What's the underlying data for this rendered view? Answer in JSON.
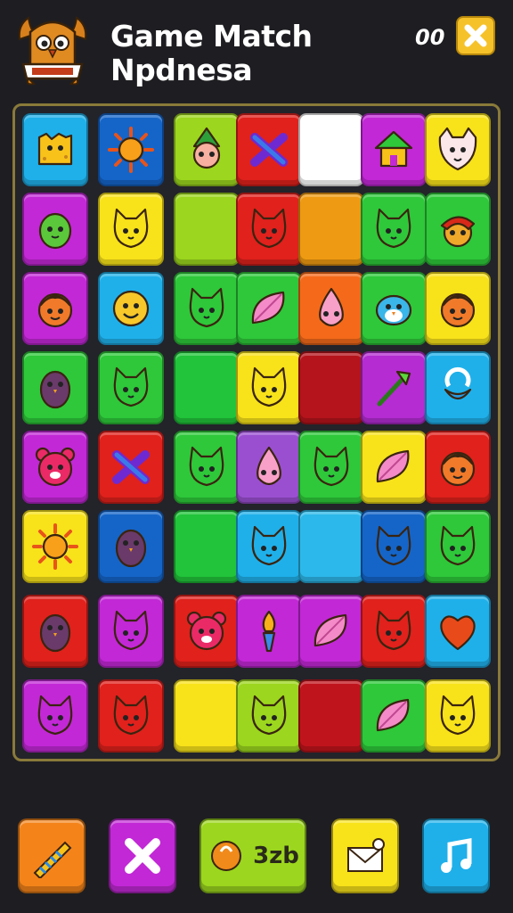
{
  "header": {
    "title_line1": "Game Match",
    "title_line2": "Npdnesa",
    "score": "00"
  },
  "board": {
    "rows": [
      [
        {
          "color": "#1fb0ea",
          "icon": "sponge"
        },
        {
          "color": "#1565c8",
          "icon": "sun"
        },
        {
          "color": "#9cd61e",
          "icon": "gnome"
        },
        {
          "color": "#e0211c",
          "icon": "cross-ribbon"
        },
        {
          "color": "#ffffff",
          "icon": "none"
        },
        {
          "color": "#c228d6",
          "icon": "house"
        },
        {
          "color": "#f8e21a",
          "icon": "fox"
        }
      ],
      [
        {
          "color": "#c228d6",
          "icon": "cactus"
        },
        {
          "color": "#f8e21a",
          "icon": "cat"
        },
        {
          "color": "#9cd61e",
          "icon": "none"
        },
        {
          "color": "#e0211c",
          "icon": "cat"
        },
        {
          "color": "#ee9a12",
          "icon": "none"
        },
        {
          "color": "#2ec83a",
          "icon": "cat"
        },
        {
          "color": "#2ec83a",
          "icon": "redhead"
        }
      ],
      [
        {
          "color": "#c228d6",
          "icon": "face"
        },
        {
          "color": "#1fb0ea",
          "icon": "smiley"
        },
        {
          "color": "#2ec83a",
          "icon": "cat"
        },
        {
          "color": "#2ec83a",
          "icon": "leaf"
        },
        {
          "color": "#f46a1a",
          "icon": "drop"
        },
        {
          "color": "#2ec83a",
          "icon": "bird"
        },
        {
          "color": "#f8e21a",
          "icon": "face"
        }
      ],
      [
        {
          "color": "#2ec83a",
          "icon": "owl"
        },
        {
          "color": "#2ec83a",
          "icon": "cat"
        },
        {
          "color": "#21c43a",
          "icon": "none"
        },
        {
          "color": "#f8e21a",
          "icon": "cat"
        },
        {
          "color": "#b5141c",
          "icon": "none"
        },
        {
          "color": "#b42cd2",
          "icon": "wand"
        },
        {
          "color": "#1fb0ea",
          "icon": "ring"
        }
      ],
      [
        {
          "color": "#c228d6",
          "icon": "bear"
        },
        {
          "color": "#e0211c",
          "icon": "cross-ribbon"
        },
        {
          "color": "#2ec83a",
          "icon": "cat"
        },
        {
          "color": "#9a4fd0",
          "icon": "drop"
        },
        {
          "color": "#2ec83a",
          "icon": "cat"
        },
        {
          "color": "#f8e21a",
          "icon": "leaf"
        },
        {
          "color": "#e0211c",
          "icon": "face"
        }
      ],
      [
        {
          "color": "#f8e21a",
          "icon": "sun"
        },
        {
          "color": "#1565c8",
          "icon": "owl"
        },
        {
          "color": "#21c43a",
          "icon": "none"
        },
        {
          "color": "#1fb0ea",
          "icon": "cat"
        },
        {
          "color": "#2cb8ea",
          "icon": "none"
        },
        {
          "color": "#1565c8",
          "icon": "cat"
        },
        {
          "color": "#2ec83a",
          "icon": "cat"
        }
      ],
      [
        {
          "color": "#e0211c",
          "icon": "owl"
        },
        {
          "color": "#c228d6",
          "icon": "cat"
        },
        {
          "color": "#e0211c",
          "icon": "bear"
        },
        {
          "color": "#c228d6",
          "icon": "torch"
        },
        {
          "color": "#c228d6",
          "icon": "leaf"
        },
        {
          "color": "#e0211c",
          "icon": "cat"
        },
        {
          "color": "#1fb0ea",
          "icon": "heart"
        }
      ],
      [
        {
          "color": "#c228d6",
          "icon": "cat"
        },
        {
          "color": "#e0211c",
          "icon": "cat"
        },
        {
          "color": "#f8e21a",
          "icon": "none"
        },
        {
          "color": "#9cd61e",
          "icon": "cat"
        },
        {
          "color": "#c0141c",
          "icon": "none"
        },
        {
          "color": "#2ec83a",
          "icon": "leaf"
        },
        {
          "color": "#f8e21a",
          "icon": "cat"
        }
      ]
    ]
  },
  "toolbar": {
    "buttons": [
      {
        "name": "rainbow-drill-button",
        "color": "#f4841a",
        "icon": "drill-icon",
        "label": ""
      },
      {
        "name": "shuffle-cross-button",
        "color": "#c228d6",
        "icon": "cross-icon",
        "label": ""
      },
      {
        "name": "coins-button",
        "color": "#9cd61e",
        "icon": "coin-icon",
        "label": "3zb"
      },
      {
        "name": "hint-button",
        "color": "#f8e21a",
        "icon": "envelope-icon",
        "label": ""
      },
      {
        "name": "music-button",
        "color": "#1fb0ea",
        "icon": "music-note-icon",
        "label": ""
      }
    ]
  }
}
